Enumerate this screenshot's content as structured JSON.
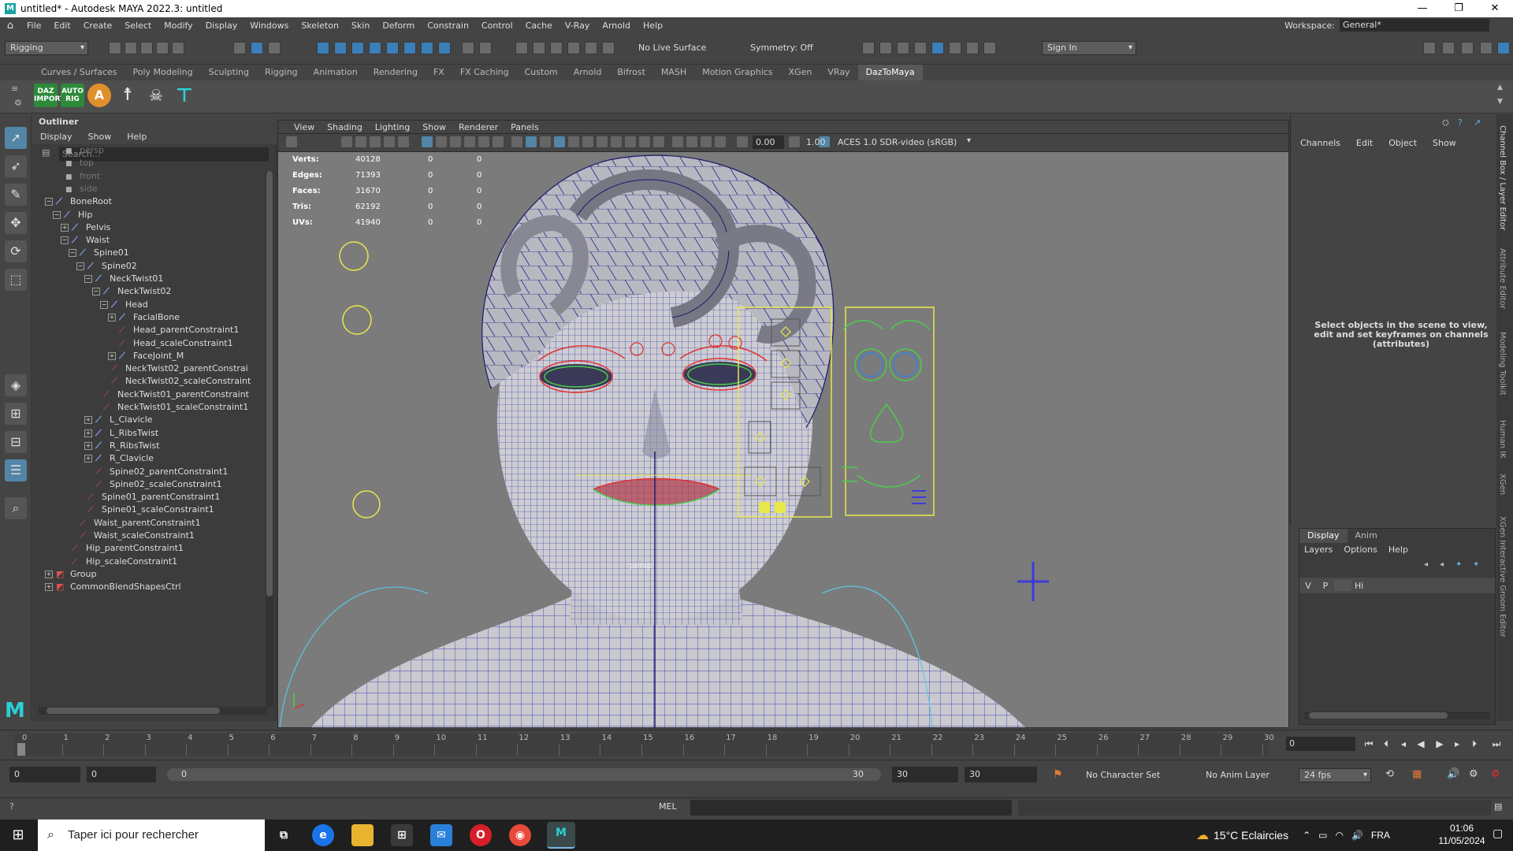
{
  "window": {
    "title": "untitled* - Autodesk MAYA 2022.3: untitled",
    "min": "—",
    "max": "❐",
    "close": "✕"
  },
  "menubar": {
    "items": [
      "File",
      "Edit",
      "Create",
      "Select",
      "Modify",
      "Display",
      "Windows",
      "Skeleton",
      "Skin",
      "Deform",
      "Constrain",
      "Control",
      "Cache",
      "V-Ray",
      "Arnold",
      "Help"
    ],
    "workspace_label": "Workspace:",
    "workspace_value": "General*"
  },
  "statusline": {
    "menuset": "Rigging",
    "live_surface": "No Live Surface",
    "symmetry": "Symmetry: Off",
    "sign_in": "Sign In"
  },
  "shelf": {
    "tabs": [
      "Curves / Surfaces",
      "Poly Modeling",
      "Sculpting",
      "Rigging",
      "Animation",
      "Rendering",
      "FX",
      "FX Caching",
      "Custom",
      "Arnold",
      "Bifrost",
      "MASH",
      "Motion Graphics",
      "XGen",
      "VRay",
      "DazToMaya"
    ],
    "active_tab": "DazToMaya",
    "buttons": [
      {
        "label": "DAZ IMPORT",
        "icon": "daz-import-icon"
      },
      {
        "label": "AUTO RIG",
        "icon": "auto-rig-icon"
      },
      {
        "label": "A",
        "icon": "a-pose-icon"
      },
      {
        "label": "",
        "icon": "t-pose-figure-icon"
      },
      {
        "label": "",
        "icon": "skull-icon"
      },
      {
        "label": "",
        "icon": "figure-cyan-icon"
      }
    ]
  },
  "outliner": {
    "title": "Outliner",
    "menu": [
      "Display",
      "Show",
      "Help"
    ],
    "search_placeholder": "Search...",
    "rows": [
      {
        "label": "persp",
        "type": "camera",
        "indent": 0,
        "dim": true
      },
      {
        "label": "top",
        "type": "camera",
        "indent": 0,
        "dim": true
      },
      {
        "label": "front",
        "type": "camera",
        "indent": 0,
        "dim": true
      },
      {
        "label": "side",
        "type": "camera",
        "indent": 0,
        "dim": true
      },
      {
        "label": "BoneRoot",
        "type": "joint",
        "indent": 0,
        "exp": "−"
      },
      {
        "label": "Hip",
        "type": "joint",
        "indent": 1,
        "exp": "−"
      },
      {
        "label": "Pelvis",
        "type": "joint",
        "indent": 2,
        "exp": "+"
      },
      {
        "label": "Waist",
        "type": "joint",
        "indent": 2,
        "exp": "−"
      },
      {
        "label": "Spine01",
        "type": "joint",
        "indent": 3,
        "exp": "−"
      },
      {
        "label": "Spine02",
        "type": "joint",
        "indent": 4,
        "exp": "−"
      },
      {
        "label": "NeckTwist01",
        "type": "joint",
        "indent": 5,
        "exp": "−"
      },
      {
        "label": "NeckTwist02",
        "type": "joint",
        "indent": 6,
        "exp": "−"
      },
      {
        "label": "Head",
        "type": "joint",
        "indent": 7,
        "exp": "−"
      },
      {
        "label": "FacialBone",
        "type": "joint",
        "indent": 8,
        "exp": "+"
      },
      {
        "label": "Head_parentConstraint1",
        "type": "constraint",
        "indent": 8
      },
      {
        "label": "Head_scaleConstraint1",
        "type": "constraint",
        "indent": 8
      },
      {
        "label": "FaceJoint_M",
        "type": "joint",
        "indent": 8,
        "exp": "+"
      },
      {
        "label": "NeckTwist02_parentConstrai",
        "type": "constraint",
        "indent": 7
      },
      {
        "label": "NeckTwist02_scaleConstraint",
        "type": "constraint",
        "indent": 7
      },
      {
        "label": "NeckTwist01_parentConstraint",
        "type": "constraint",
        "indent": 6
      },
      {
        "label": "NeckTwist01_scaleConstraint1",
        "type": "constraint",
        "indent": 6
      },
      {
        "label": "L_Clavicle",
        "type": "joint",
        "indent": 5,
        "exp": "+"
      },
      {
        "label": "L_RibsTwist",
        "type": "joint",
        "indent": 5,
        "exp": "+"
      },
      {
        "label": "R_RibsTwist",
        "type": "joint",
        "indent": 5,
        "exp": "+"
      },
      {
        "label": "R_Clavicle",
        "type": "joint",
        "indent": 5,
        "exp": "+"
      },
      {
        "label": "Spine02_parentConstraint1",
        "type": "constraint",
        "indent": 5
      },
      {
        "label": "Spine02_scaleConstraint1",
        "type": "constraint",
        "indent": 5
      },
      {
        "label": "Spine01_parentConstraint1",
        "type": "constraint",
        "indent": 4
      },
      {
        "label": "Spine01_scaleConstraint1",
        "type": "constraint",
        "indent": 4
      },
      {
        "label": "Waist_parentConstraint1",
        "type": "constraint",
        "indent": 3
      },
      {
        "label": "Waist_scaleConstraint1",
        "type": "constraint",
        "indent": 3
      },
      {
        "label": "Hip_parentConstraint1",
        "type": "constraint",
        "indent": 2
      },
      {
        "label": "Hip_scaleConstraint1",
        "type": "constraint",
        "indent": 2
      },
      {
        "label": "Group",
        "type": "group",
        "indent": 0,
        "exp": "+"
      },
      {
        "label": "CommonBlendShapesCtrl",
        "type": "group",
        "indent": 0,
        "exp": "+"
      }
    ]
  },
  "viewport": {
    "menu": [
      "View",
      "Shading",
      "Lighting",
      "Show",
      "Renderer",
      "Panels"
    ],
    "gamma": "0.00",
    "exposure": "1.00",
    "colorspace": "ACES 1.0 SDR-video (sRGB)",
    "hud": [
      {
        "label": "Verts:",
        "value": "40128",
        "a": "0",
        "b": "0"
      },
      {
        "label": "Edges:",
        "value": "71393",
        "a": "0",
        "b": "0"
      },
      {
        "label": "Faces:",
        "value": "31670",
        "a": "0",
        "b": "0"
      },
      {
        "label": "Tris:",
        "value": "62192",
        "a": "0",
        "b": "0"
      },
      {
        "label": "UVs:",
        "value": "41940",
        "a": "0",
        "b": "0"
      }
    ],
    "camera_label": "persp"
  },
  "channelbox": {
    "menu": [
      "Channels",
      "Edit",
      "Object",
      "Show"
    ],
    "hint": "Select objects in the scene to view, edit and set keyframes on channels (attributes)"
  },
  "layers": {
    "tabs": [
      "Display",
      "Anim"
    ],
    "menu": [
      "Layers",
      "Options",
      "Help"
    ],
    "row": {
      "v": "V",
      "p": "P",
      "name": "Hi"
    }
  },
  "side_tabs": [
    "Channel Box / Layer Editor",
    "Attribute Editor",
    "Modeling Toolkit",
    "Human IK",
    "XGen",
    "XGen Interactive Groom Editor"
  ],
  "timeslider": {
    "ticks": [
      "0",
      "1",
      "2",
      "3",
      "4",
      "5",
      "6",
      "7",
      "8",
      "9",
      "10",
      "11",
      "12",
      "13",
      "14",
      "15",
      "16",
      "17",
      "18",
      "19",
      "20",
      "21",
      "22",
      "23",
      "24",
      "25",
      "26",
      "27",
      "28",
      "29",
      "30"
    ],
    "current_frame": "0"
  },
  "rangeslider": {
    "start": "0",
    "anim_start": "0",
    "range_start": "0",
    "range_end": "30",
    "end": "30",
    "anim_end": "30",
    "character_set": "No Character Set",
    "anim_layer": "No Anim Layer",
    "fps": "24 fps"
  },
  "cmdline": {
    "lang": "MEL"
  },
  "taskbar": {
    "search_placeholder": "Taper ici pour rechercher",
    "weather": "15°C  Eclaircies",
    "lang": "FRA",
    "time": "01:06",
    "date": "11/05/2024"
  },
  "colors": {
    "accent": "#5285a6",
    "wire": "#1a1aa8",
    "mesh": "#c8c8cc",
    "ctrl_yellow": "#e8e84a",
    "ctrl_green": "#4ccc4c",
    "ctrl_red": "#e03030"
  }
}
